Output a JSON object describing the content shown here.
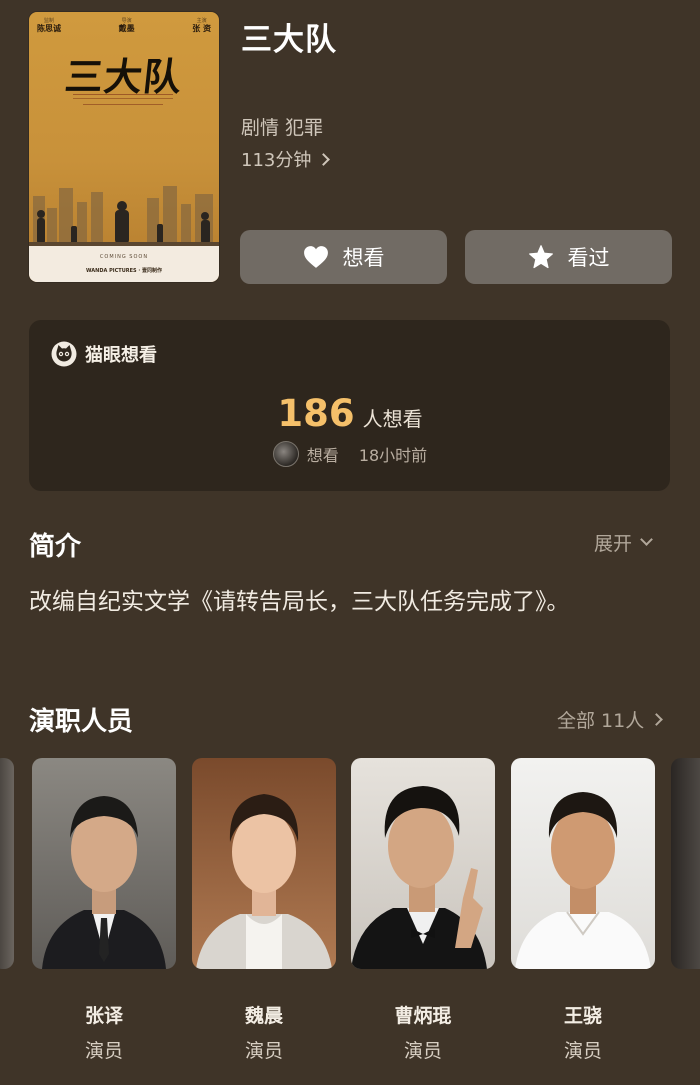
{
  "movie": {
    "title": "三大队",
    "genres": "剧情 犯罪",
    "duration": "113分钟"
  },
  "poster": {
    "title": "三大队",
    "credits": [
      {
        "role": "监制",
        "name": "陈思诚"
      },
      {
        "role": "导演",
        "name": "戴墨"
      },
      {
        "role": "主演",
        "name": "张 资"
      }
    ],
    "coming": "COMING SOON",
    "logos": "WANDA PICTURES · 壹同制作"
  },
  "actions": {
    "want_label": "想看",
    "seen_label": "看过"
  },
  "maoyan": {
    "title": "猫眼想看",
    "count": "186",
    "count_unit": "人想看",
    "recent_action": "想看",
    "recent_time": "18小时前"
  },
  "intro": {
    "heading": "简介",
    "expand_label": "展开",
    "text": "改编自纪实文学《请转告局长，三大队任务完成了》。"
  },
  "cast": {
    "heading": "演职人员",
    "all_label": "全部 11人",
    "members": [
      {
        "name": "张译",
        "role": "演员"
      },
      {
        "name": "魏晨",
        "role": "演员"
      },
      {
        "name": "曹炳琨",
        "role": "演员"
      },
      {
        "name": "王骁",
        "role": "演员"
      }
    ]
  },
  "colors": {
    "background": "#3f3428",
    "card": "#2e261d",
    "accent": "#f5c06a",
    "button": "#716b64"
  },
  "icons": {
    "want": "heart-icon",
    "seen": "star-icon",
    "maoyan": "cat-icon"
  }
}
